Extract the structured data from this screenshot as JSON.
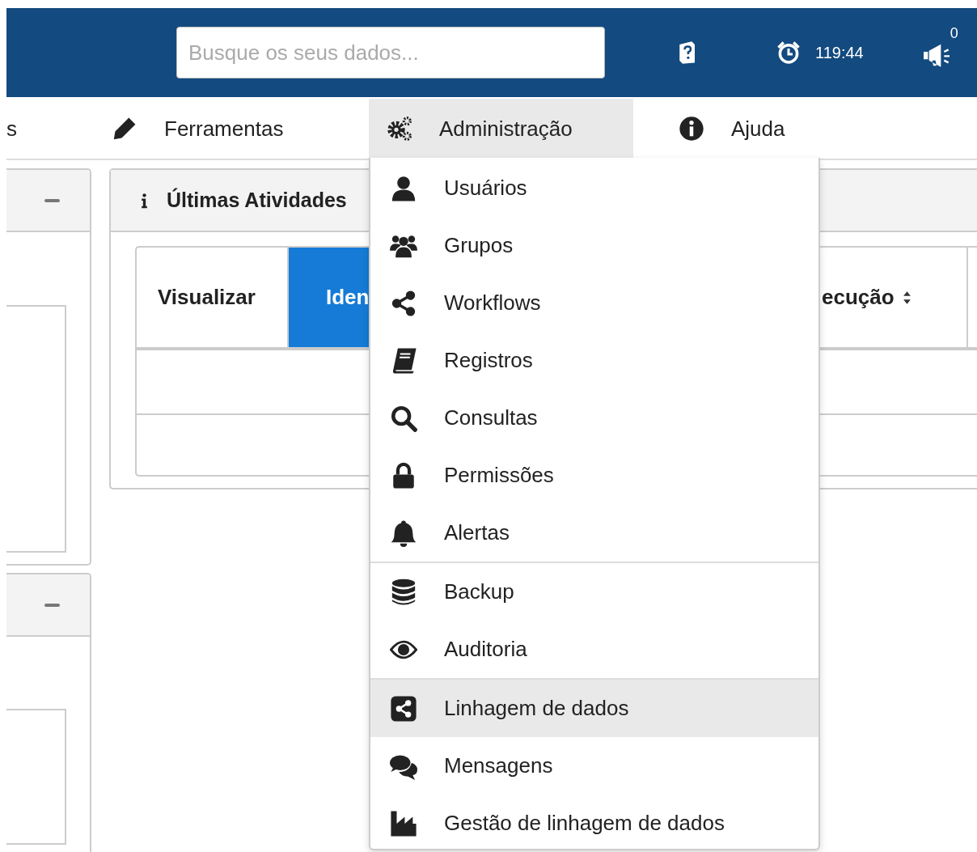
{
  "top_bar": {
    "search": {
      "placeholder": "Busque os seus dados..."
    },
    "timer": "119:44",
    "notifications": "0"
  },
  "nav": [
    {
      "label": "s",
      "selected": false
    },
    {
      "label": "Ferramentas",
      "selected": false
    },
    {
      "label": "Administração",
      "selected": true
    },
    {
      "label": "Ajuda",
      "selected": false
    }
  ],
  "activity_panel": {
    "title": "Últimas Atividades",
    "columns": [
      {
        "label": "Visualizar",
        "selected": false,
        "sortable": false
      },
      {
        "label": "Iden",
        "selected": true,
        "sortable": false
      },
      {
        "label": "ecução",
        "selected": false,
        "sortable": true
      }
    ]
  },
  "dropdown": {
    "sections": [
      [
        {
          "label": "Usuários",
          "selected": false
        },
        {
          "label": "Grupos",
          "selected": false
        },
        {
          "label": "Workflows",
          "selected": false
        },
        {
          "label": "Registros",
          "selected": false
        },
        {
          "label": "Consultas",
          "selected": false
        },
        {
          "label": "Permissões",
          "selected": false
        },
        {
          "label": "Alertas",
          "selected": false
        }
      ],
      [
        {
          "label": "Backup",
          "selected": false
        },
        {
          "label": "Auditoria",
          "selected": false
        }
      ],
      [
        {
          "label": "Linhagem de dados",
          "selected": true
        },
        {
          "label": "Mensagens",
          "selected": false
        },
        {
          "label": "Gestão de linhagem de dados",
          "selected": false
        }
      ]
    ]
  }
}
